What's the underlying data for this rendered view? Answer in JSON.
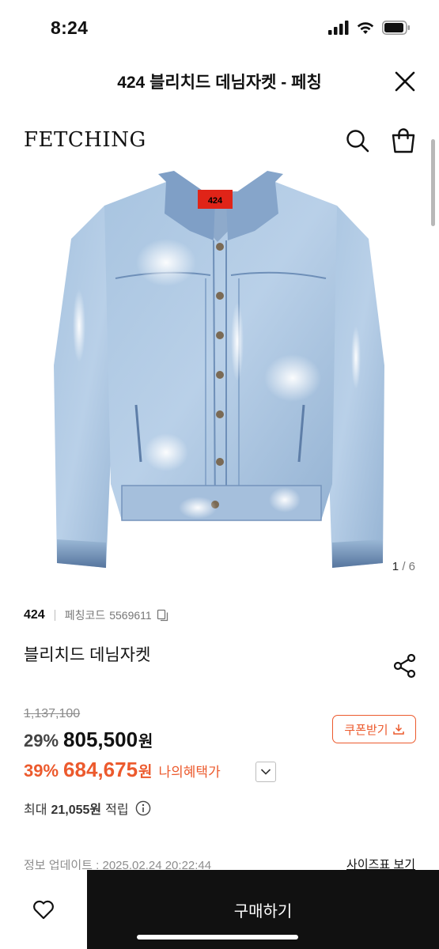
{
  "status_bar": {
    "time": "8:24",
    "icons": [
      "signal-icon",
      "wifi-icon",
      "battery-icon"
    ]
  },
  "modal": {
    "title": "424 블리치드 데님자켓 - 페칭"
  },
  "store": {
    "logo": "FETCHING"
  },
  "gallery": {
    "current": "1",
    "separator": "/",
    "total": "6",
    "collar_label": "424"
  },
  "product": {
    "brand": "424",
    "code_label": "페칭코드",
    "code_value": "5569611",
    "name": "블리치드 데님자켓"
  },
  "pricing": {
    "original_price": "1,137,100",
    "discount_1": "29%",
    "price_1": "805,500",
    "currency_1": "원",
    "discount_2": "39%",
    "price_2": "684,675",
    "currency_2": "원",
    "benefit_label": "나의혜택가",
    "coupon_label": "쿠폰받기",
    "accent_color": "#ec5a2d"
  },
  "points": {
    "prefix": "최대",
    "value": "21,055원",
    "suffix": "적립"
  },
  "meta": {
    "update_text": "정보 업데이트 : 2025.02.24 20:22:44",
    "size_chart_label": "사이즈표 보기"
  },
  "bottom_bar": {
    "buy_label": "구매하기"
  }
}
